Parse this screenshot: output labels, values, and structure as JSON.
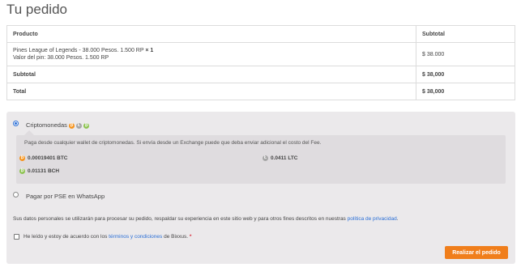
{
  "page_title": "Tu pedido",
  "table": {
    "header": {
      "product": "Producto",
      "subtotal": "Subtotal"
    },
    "item": {
      "name": "Pines League of Legends - 38.000 Pesos. 1.500 RP",
      "qty": "× 1",
      "meta": "Valor del pin: 38.000 Pesos. 1.500 RP",
      "subtotal": "$ 38.000"
    },
    "subtotal_row": {
      "label": "Subtotal",
      "value": "$ 38,000"
    },
    "total_row": {
      "label": "Total",
      "value": "$ 38,000"
    }
  },
  "payment": {
    "crypto": {
      "label": "Criptomonedas",
      "selected": true,
      "icons": [
        "bitcoin-icon",
        "litecoin-icon",
        "bitcoin-cash-icon"
      ],
      "description": "Paga desde cualquier wallet de criptomonedas. Si envía desde un Exchange puede que deba enviar adicional el costo del Fee.",
      "amounts": {
        "btc": "0.00019401 BTC",
        "ltc": "0.0411 LTC",
        "bch": "0.01131 BCH"
      }
    },
    "pse": {
      "label": "Pagar por PSE en WhatsApp",
      "selected": false
    }
  },
  "privacy": {
    "text": "Sus datos personales se utilizarán para procesar su pedido, respaldar su experiencia en este sitio web y para otros fines descritos en nuestras",
    "link": "política de privacidad",
    "end": "."
  },
  "terms": {
    "prefix": "He leído y estoy de acuerdo con los",
    "link": "términos y condiciones",
    "suffix": "de Bixxus.",
    "required_mark": "*",
    "checked": false
  },
  "place_order_label": "Realizar el pedido",
  "colors": {
    "accent": "#f07e1b",
    "link": "#2b6fd6",
    "panel": "#ebe9eb",
    "btc": "#f7931a",
    "ltc": "#a6a6a6",
    "bch": "#8dc351"
  }
}
